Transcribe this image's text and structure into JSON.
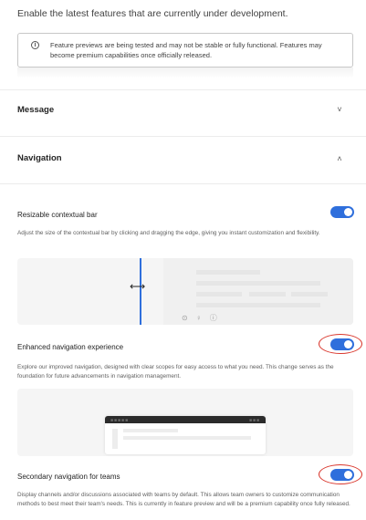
{
  "intro_text": "Enable the latest features that are currently under development.",
  "notice": {
    "icon": "info-icon",
    "text": "Feature previews are being tested and may not be stable or fully functional. Features may become premium capabilities once officially released."
  },
  "sections": {
    "message": {
      "title": "Message",
      "chevron": "˅"
    },
    "navigation": {
      "title": "Navigation",
      "chevron": "˄"
    }
  },
  "settings": [
    {
      "title": "Resizable contextual bar",
      "description": "Adjust the size of the contextual bar by clicking and dragging the edge, giving you instant customization and flexibility.",
      "enabled": true
    },
    {
      "title": "Enhanced navigation experience",
      "description": "Explore our improved navigation, designed with clear scopes for easy access to what you need. This change serves as the foundation for future advancements in navigation management.",
      "enabled": true
    },
    {
      "title": "Secondary navigation for teams",
      "description": "Display channels and/or discussions associated with teams by default. This allows team owners to customize communication methods to best meet their team's needs. This is currently in feature preview and will be a premium capability once fully released.",
      "enabled": true
    }
  ],
  "colors": {
    "accent": "#2f6fdc",
    "annotation": "#d9362c"
  }
}
